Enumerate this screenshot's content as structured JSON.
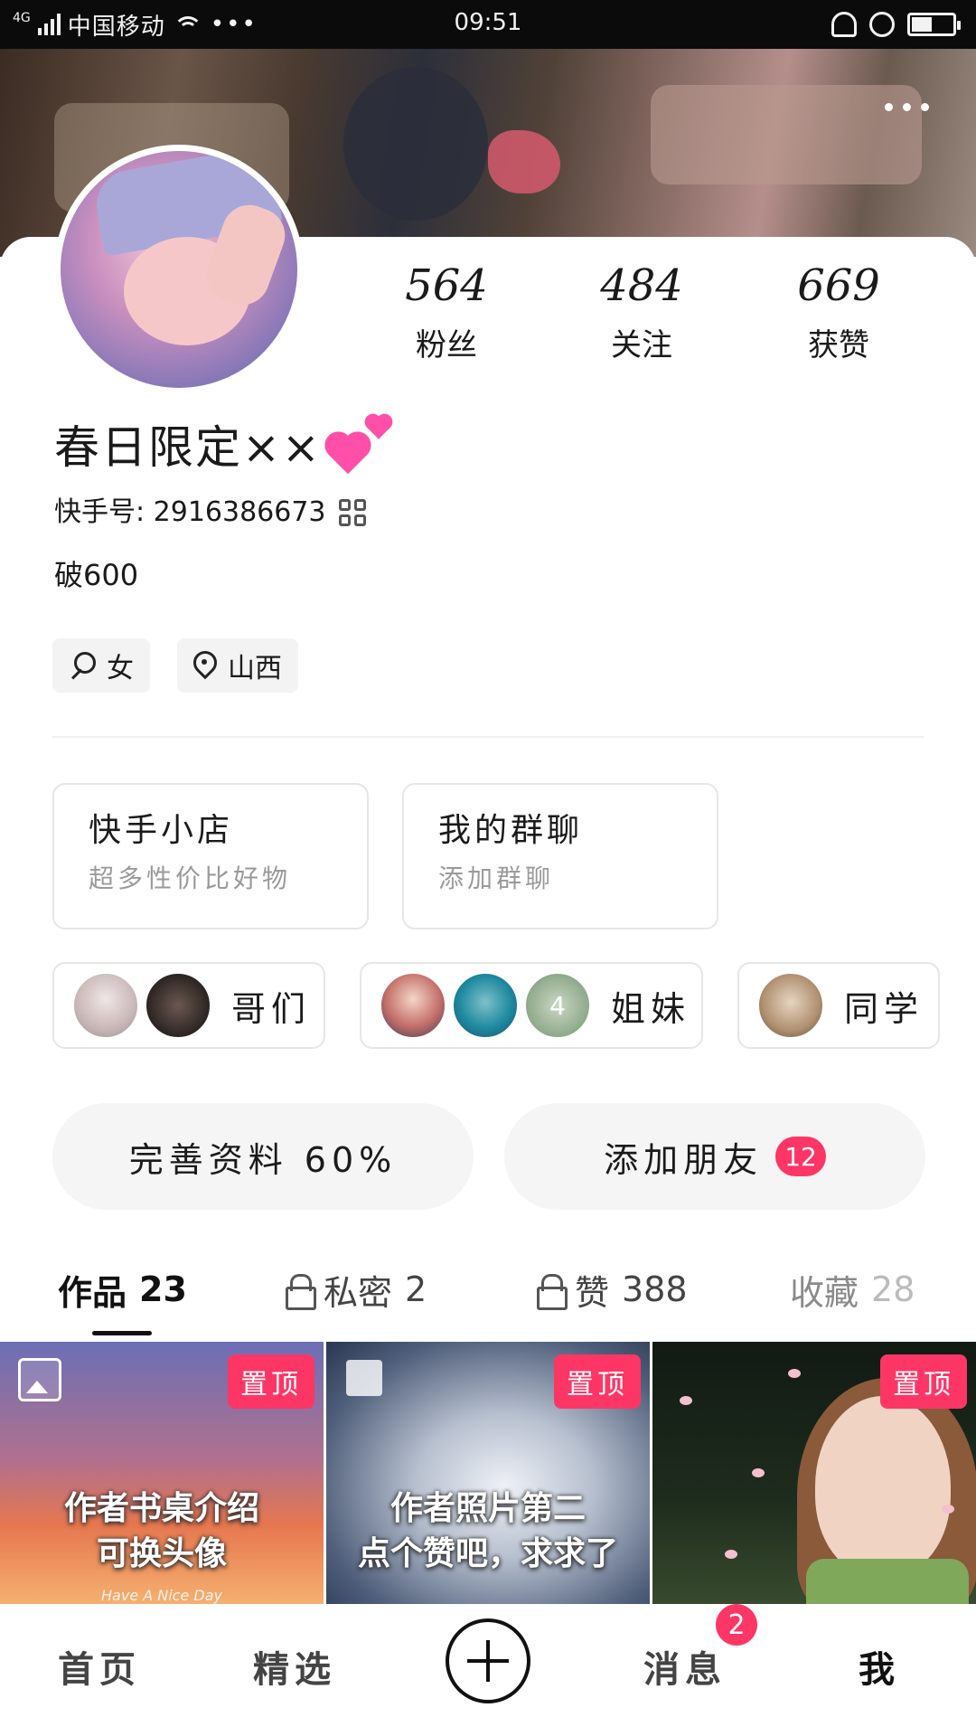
{
  "status_bar": {
    "network": "4G",
    "carrier": "中国移动",
    "dots": "•••",
    "time": "09:51",
    "battery_level": 0.45
  },
  "profile": {
    "stats": [
      {
        "value": "564",
        "label": "粉丝"
      },
      {
        "value": "484",
        "label": "关注"
      },
      {
        "value": "669",
        "label": "获赞"
      }
    ],
    "nickname": "春日限定××",
    "kwai_id": "快手号: 2916386673",
    "bio": "破600",
    "tags": [
      {
        "icon": "gender-female-icon",
        "label": "女"
      },
      {
        "icon": "location-pin-icon",
        "label": "山西"
      }
    ]
  },
  "features": [
    {
      "title": "快手小店",
      "subtitle": "超多性价比好物"
    },
    {
      "title": "我的群聊",
      "subtitle": "添加群聊"
    }
  ],
  "groups": [
    {
      "label": "哥们"
    },
    {
      "label": "姐妹",
      "extra_count": "4"
    },
    {
      "label": "同学"
    }
  ],
  "actions": {
    "complete_profile": "完善资料 60%",
    "add_friends": "添加朋友",
    "add_friends_badge": "12"
  },
  "tabs": [
    {
      "label": "作品",
      "count": "23"
    },
    {
      "label": "私密",
      "count": "2"
    },
    {
      "label": "赞",
      "count": "388"
    },
    {
      "label": "收藏",
      "count": "28"
    }
  ],
  "posts": [
    {
      "caption_line1": "作者书桌介绍",
      "caption_line2": "可换头像",
      "sub": "Have A Nice Day",
      "badge": "置顶"
    },
    {
      "caption_line1": "作者照片第二",
      "caption_line2": "点个赞吧，求求了",
      "badge": "置顶"
    },
    {
      "badge": "置顶"
    }
  ],
  "bottom_nav": {
    "home": "首页",
    "featured": "精选",
    "messages": "消息",
    "messages_badge": "2",
    "me": "我"
  },
  "colors": {
    "accent": "#fe3666",
    "card_bg": "#ffffff",
    "chip_bg": "#f3f3f3"
  }
}
